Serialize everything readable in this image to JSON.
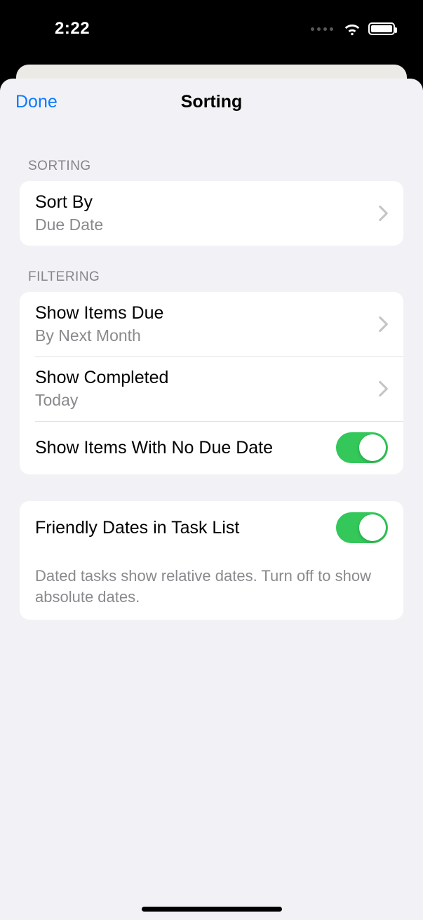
{
  "status": {
    "time": "2:22"
  },
  "nav": {
    "done": "Done",
    "title": "Sorting"
  },
  "sections": {
    "sorting_header": "SORTING",
    "filtering_header": "FILTERING"
  },
  "sort_by": {
    "title": "Sort By",
    "value": "Due Date"
  },
  "show_items_due": {
    "title": "Show Items Due",
    "value": "By Next Month"
  },
  "show_completed": {
    "title": "Show Completed",
    "value": "Today"
  },
  "no_due_date": {
    "title": "Show Items With No Due Date",
    "on": true
  },
  "friendly_dates": {
    "title": "Friendly Dates in Task List",
    "on": true,
    "footer": "Dated tasks show relative dates. Turn off to show absolute dates."
  }
}
